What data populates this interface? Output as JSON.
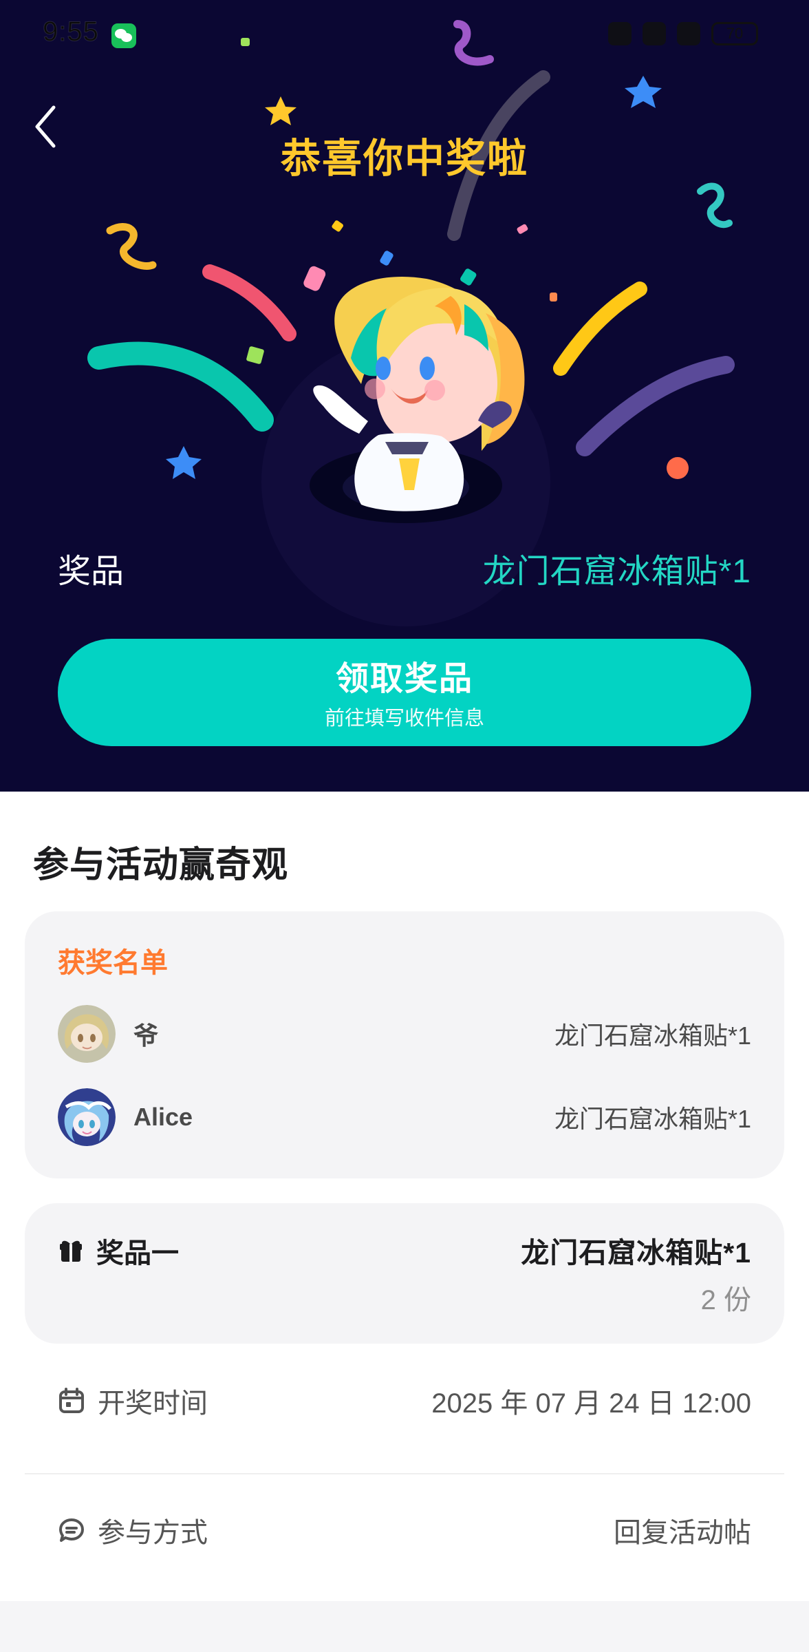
{
  "status_bar": {
    "time": "9:55",
    "battery": "70"
  },
  "hero": {
    "title": "恭喜你中奖啦",
    "prize_label": "奖品",
    "prize_value": "龙门石窟冰箱贴*1",
    "claim_button": {
      "title": "领取奖品",
      "subtitle": "前往填写收件信息"
    }
  },
  "main": {
    "section_title": "参与活动赢奇观",
    "winner_list": {
      "title": "获奖名单",
      "items": [
        {
          "name": "爷",
          "prize": "龙门石窟冰箱贴*1"
        },
        {
          "name": "Alice",
          "prize": "龙门石窟冰箱贴*1"
        }
      ]
    },
    "prize_card": {
      "label": "奖品一",
      "value": "龙门石窟冰箱贴*1",
      "count": "2 份"
    },
    "draw_time": {
      "label": "开奖时间",
      "value": "2025 年 07 月 24 日 12:00"
    },
    "participation": {
      "label": "参与方式",
      "value": "回复活动帖"
    }
  },
  "colors": {
    "hero_background": "#0b0733",
    "accent_teal": "#03d3c3",
    "gold_title": "#ffc82c",
    "winner_title_orange": "#ff7a30"
  }
}
